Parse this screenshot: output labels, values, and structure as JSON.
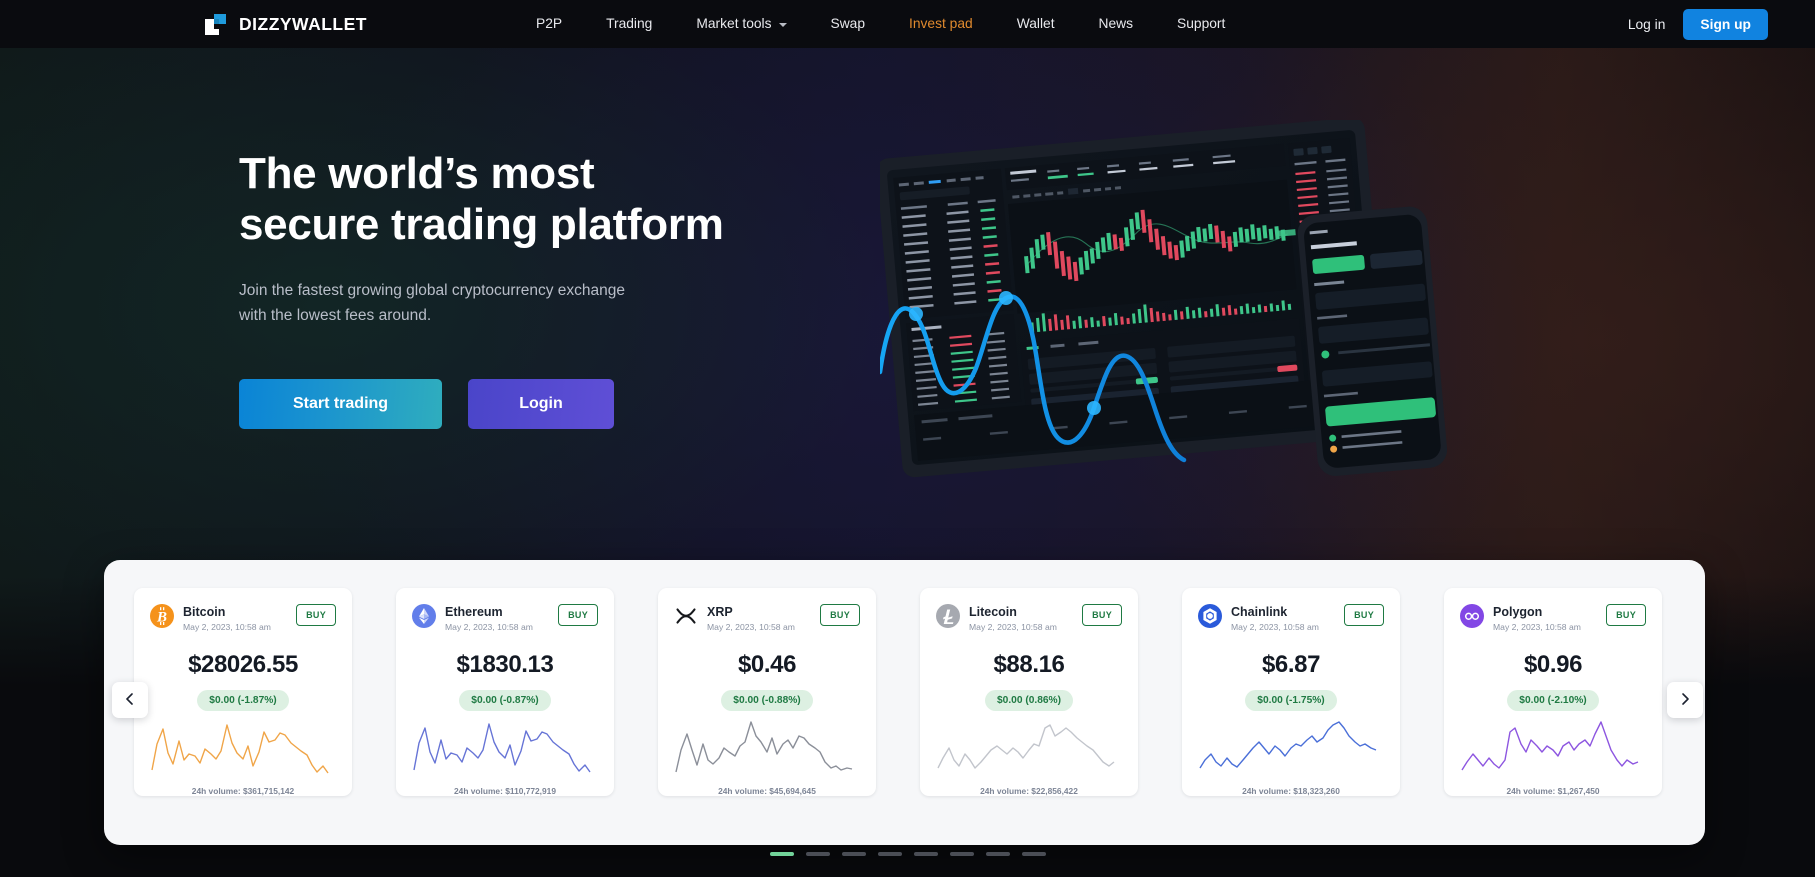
{
  "brand": {
    "name": "DIZZYWALLET",
    "logo_icon": "dizzywallet-logo-icon"
  },
  "nav": {
    "links": [
      {
        "label": "P2P",
        "accent": false,
        "caret": false
      },
      {
        "label": "Trading",
        "accent": false,
        "caret": false
      },
      {
        "label": "Market tools",
        "accent": false,
        "caret": true
      },
      {
        "label": "Swap",
        "accent": false,
        "caret": false
      },
      {
        "label": "Invest pad",
        "accent": true,
        "caret": false
      },
      {
        "label": "Wallet",
        "accent": false,
        "caret": false
      },
      {
        "label": "News",
        "accent": false,
        "caret": false
      },
      {
        "label": "Support",
        "accent": false,
        "caret": false
      }
    ],
    "login_label": "Log in",
    "signup_label": "Sign up",
    "accent_color": "#e08a2e",
    "signup_color": "#1183e0"
  },
  "hero": {
    "title_line1": "The world’s most",
    "title_line2": "secure trading platform",
    "subtitle_line1": "Join the fastest growing global cryptocurrency exchange",
    "subtitle_line2": "with the lowest fees around.",
    "primary_button": "Start trading",
    "secondary_button": "Login",
    "artwork_icon": "trading-dashboard-devices-illustration"
  },
  "carousel": {
    "prev_icon": "chevron-left-icon",
    "next_icon": "chevron-right-icon",
    "buy_label": "BUY",
    "volume_prefix": "24h volume: ",
    "pages": 8,
    "active_page": 1,
    "active_color": "#72d39a",
    "cards": [
      {
        "name": "Bitcoin",
        "icon": "bitcoin-icon",
        "icon_color": "#f5921b",
        "timestamp": "May 2, 2023, 10:58 am",
        "price": "$28026.55",
        "change": "$0.00 (-1.87%)",
        "volume": "24h volume: $361,715,142",
        "spark_color": "#f0a548",
        "buy_label": "BUY"
      },
      {
        "name": "Ethereum",
        "icon": "ethereum-icon",
        "icon_color": "#627eea",
        "timestamp": "May 2, 2023, 10:58 am",
        "price": "$1830.13",
        "change": "$0.00 (-0.87%)",
        "volume": "24h volume: $110,772,919",
        "spark_color": "#6674d6",
        "buy_label": "BUY"
      },
      {
        "name": "XRP",
        "icon": "xrp-icon",
        "icon_color": "#16181c",
        "timestamp": "May 2, 2023, 10:58 am",
        "price": "$0.46",
        "change": "$0.00 (-0.88%)",
        "volume": "24h volume: $45,694,645",
        "spark_color": "#8b8f99",
        "buy_label": "BUY"
      },
      {
        "name": "Litecoin",
        "icon": "litecoin-icon",
        "icon_color": "#a6a9b0",
        "timestamp": "May 2, 2023, 10:58 am",
        "price": "$88.16",
        "change": "$0.00 (0.86%)",
        "volume": "24h volume: $22,856,422",
        "spark_color": "#c2c5cc",
        "buy_label": "BUY"
      },
      {
        "name": "Chainlink",
        "icon": "chainlink-icon",
        "icon_color": "#2a5ada",
        "timestamp": "May 2, 2023, 10:58 am",
        "price": "$6.87",
        "change": "$0.00 (-1.75%)",
        "volume": "24h volume: $18,323,260",
        "spark_color": "#4a6fd8",
        "buy_label": "BUY"
      },
      {
        "name": "Polygon",
        "icon": "polygon-icon",
        "icon_color": "#8247e5",
        "timestamp": "May 2, 2023, 10:58 am",
        "price": "$0.96",
        "change": "$0.00 (-2.10%)",
        "volume": "24h volume: $1,267,450",
        "spark_color": "#8d56e0",
        "buy_label": "BUY"
      }
    ]
  },
  "chart_data": {
    "type": "line",
    "title": "24h price sparklines",
    "series": [
      {
        "name": "Bitcoin",
        "values": [
          8,
          42,
          58,
          30,
          18,
          50,
          24,
          30,
          28,
          22,
          38,
          30,
          26,
          34,
          70,
          46,
          36,
          30,
          44,
          20,
          34,
          60,
          50,
          52,
          58,
          56,
          48,
          44,
          40,
          36,
          24,
          14,
          22,
          10
        ]
      },
      {
        "name": "Ethereum",
        "values": [
          8,
          44,
          60,
          32,
          20,
          52,
          26,
          32,
          30,
          24,
          40,
          32,
          28,
          36,
          72,
          48,
          38,
          32,
          46,
          22,
          36,
          62,
          52,
          54,
          60,
          58,
          50,
          46,
          42,
          38,
          26,
          16,
          24,
          10
        ]
      },
      {
        "name": "XRP",
        "values": [
          4,
          34,
          52,
          30,
          16,
          46,
          22,
          18,
          24,
          34,
          30,
          26,
          36,
          40,
          74,
          58,
          50,
          40,
          54,
          36,
          48,
          52,
          44,
          58,
          56,
          50,
          46,
          40,
          28,
          18,
          22,
          16,
          20,
          18
        ]
      },
      {
        "name": "Litecoin",
        "values": [
          10,
          26,
          40,
          22,
          14,
          34,
          26,
          16,
          22,
          30,
          38,
          44,
          40,
          34,
          42,
          38,
          30,
          40,
          48,
          46,
          70,
          74,
          62,
          66,
          70,
          64,
          58,
          54,
          50,
          44,
          38,
          30,
          26,
          30
        ]
      },
      {
        "name": "Chainlink",
        "values": [
          10,
          22,
          30,
          20,
          14,
          26,
          18,
          14,
          22,
          30,
          38,
          46,
          40,
          34,
          42,
          38,
          32,
          40,
          44,
          42,
          48,
          52,
          46,
          50,
          58,
          64,
          76,
          70,
          60,
          54,
          50,
          52,
          48,
          46
        ]
      },
      {
        "name": "Polygon",
        "values": [
          6,
          20,
          32,
          22,
          14,
          26,
          18,
          12,
          20,
          56,
          64,
          48,
          40,
          50,
          44,
          38,
          44,
          40,
          34,
          44,
          48,
          40,
          46,
          50,
          44,
          56,
          72,
          60,
          46,
          34,
          28,
          34,
          30,
          32
        ]
      }
    ],
    "xlabel": "",
    "ylabel": "",
    "grid": false,
    "legend": false
  }
}
